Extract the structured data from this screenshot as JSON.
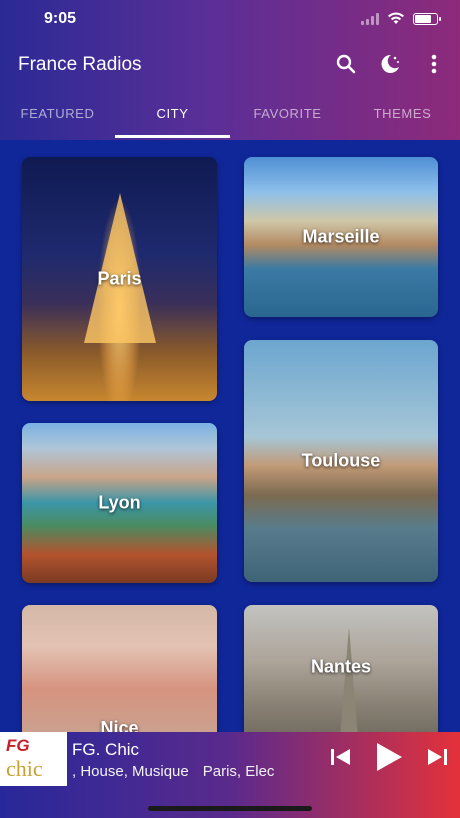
{
  "status": {
    "time": "9:05",
    "battery_fraction": 0.78
  },
  "app": {
    "title": "France Radios"
  },
  "icons": {
    "search": "search-icon",
    "night_mode": "moon-stars-icon",
    "menu": "more-vertical-icon"
  },
  "tabs": [
    {
      "label": "FEATURED",
      "active": false
    },
    {
      "label": "CITY",
      "active": true
    },
    {
      "label": "FAVORITE",
      "active": false
    },
    {
      "label": "THEMES",
      "active": false
    }
  ],
  "cities": [
    {
      "name": "Paris"
    },
    {
      "name": "Marseille"
    },
    {
      "name": "Lyon"
    },
    {
      "name": "Toulouse"
    },
    {
      "name": "Nice"
    },
    {
      "name": "Nantes"
    }
  ],
  "player": {
    "station": "FG. Chic",
    "logo_line1": "FG",
    "logo_line2": "chic",
    "subtitle_part1": ", House, Musique",
    "subtitle_part2": "Paris, Elec"
  },
  "colors": {
    "accent_red": "#e4313a",
    "background": "#10279a"
  }
}
